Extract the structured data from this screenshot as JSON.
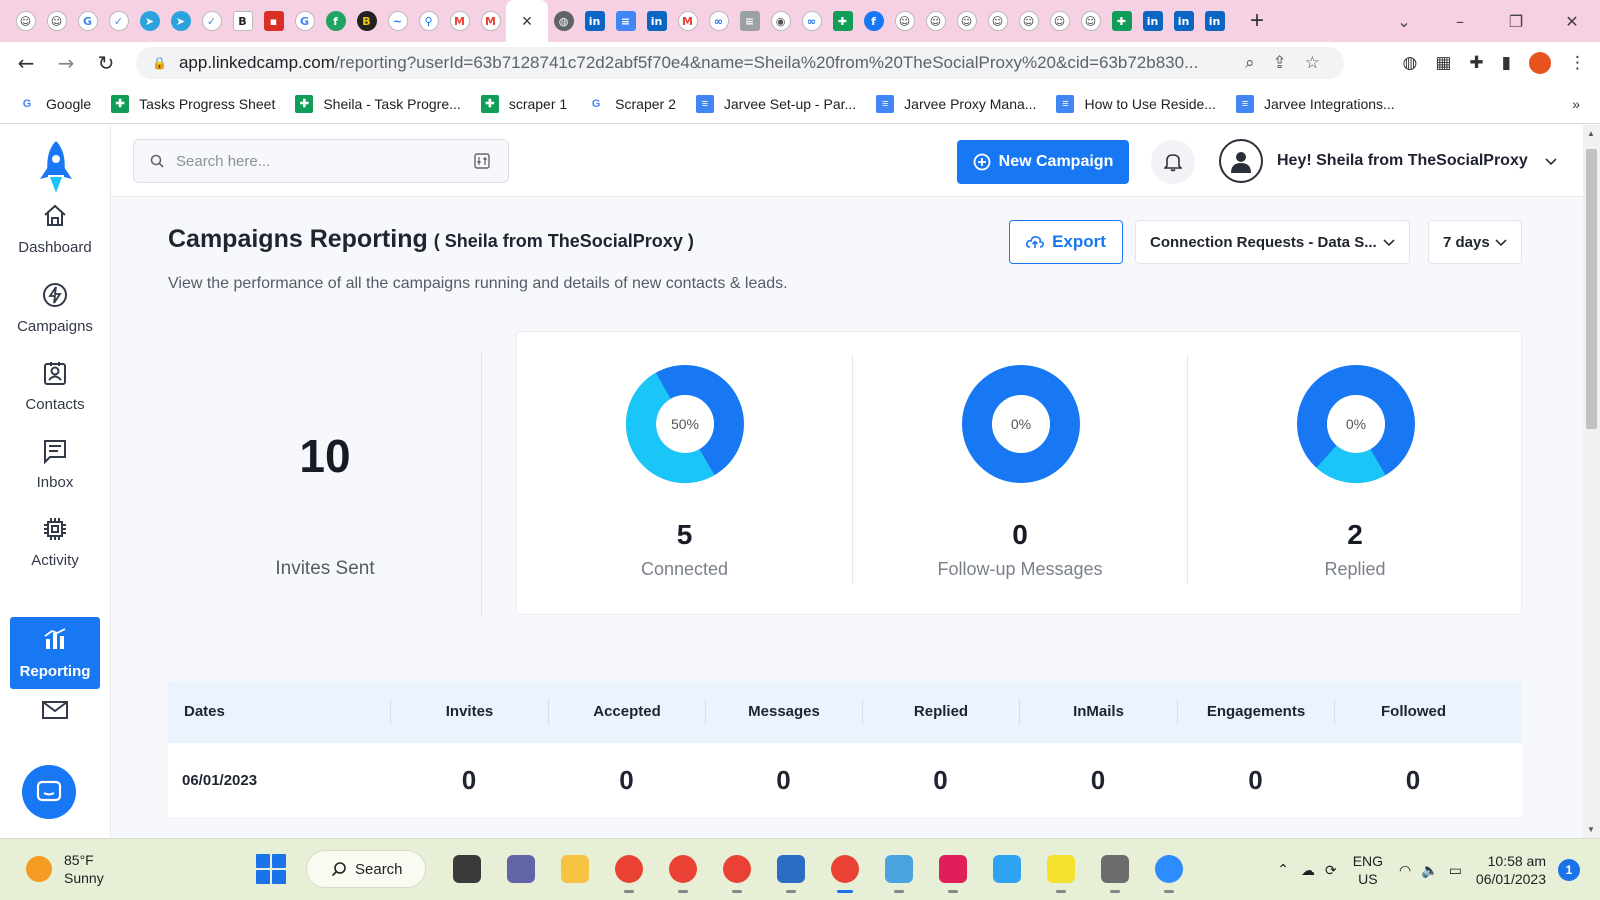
{
  "colors": {
    "accent": "#1877f2",
    "donut_primary": "#1877f2",
    "donut_secondary": "#19c6f7",
    "tab_strip": "#f6d1e4",
    "taskbar": "#e7f0d6"
  },
  "browser": {
    "tab_icons": [
      "chrome-dino-icon",
      "chrome-dino-icon",
      "google-icon",
      "double-check-icon",
      "telegram-icon",
      "telegram-icon",
      "double-check-icon",
      "bold-b-icon",
      "red-app-icon",
      "google-icon",
      "green-f-icon",
      "bh-icon",
      "blue-swirl-icon",
      "pin-icon",
      "gmail-icon",
      "gmail-icon"
    ],
    "active_tab_close": "×",
    "tab_icons_right": [
      "globe-icon",
      "linkedin-icon",
      "docs-icon",
      "linkedin-icon",
      "gmail-icon",
      "link-icon",
      "doc-icon",
      "chrome-icon",
      "link-icon",
      "sheets-icon",
      "facebook-icon",
      "chrome-dino-icon",
      "chrome-dino-icon",
      "chrome-dino-icon",
      "chrome-dino-icon",
      "chrome-dino-icon",
      "chrome-dino-icon",
      "chrome-dino-icon",
      "sheets-icon",
      "linkedin-icon",
      "linkedin-icon",
      "linkedin-icon"
    ],
    "url_host": "app.linkedcamp.com",
    "url_rest": "/reporting?userId=63b7128741c72d2abf5f70e4&name=Sheila%20from%20TheSocialProxy%20&cid=63b72b830...",
    "bookmarks": [
      {
        "label": "Google",
        "icon": "google-icon"
      },
      {
        "label": "Tasks Progress Sheet",
        "icon": "sheets-icon"
      },
      {
        "label": "Sheila - Task Progre...",
        "icon": "sheets-icon"
      },
      {
        "label": "scraper 1",
        "icon": "sheets-icon"
      },
      {
        "label": "Scraper 2",
        "icon": "google-icon"
      },
      {
        "label": "Jarvee Set-up - Par...",
        "icon": "docs-icon"
      },
      {
        "label": "Jarvee Proxy Mana...",
        "icon": "docs-icon"
      },
      {
        "label": "How to Use Reside...",
        "icon": "docs-icon"
      },
      {
        "label": "Jarvee Integrations...",
        "icon": "docs-icon"
      }
    ],
    "bookmarks_more": "»"
  },
  "sidebar": {
    "items": [
      {
        "label": "Dashboard",
        "icon": "home-icon"
      },
      {
        "label": "Campaigns",
        "icon": "lightning-icon"
      },
      {
        "label": "Contacts",
        "icon": "contact-card-icon"
      },
      {
        "label": "Inbox",
        "icon": "message-icon"
      },
      {
        "label": "Activity",
        "icon": "chip-icon"
      },
      {
        "label": "Reporting",
        "icon": "bar-chart-icon"
      }
    ]
  },
  "topbar": {
    "search_placeholder": "Search here...",
    "new_campaign": "New Campaign",
    "user_greeting": "Hey! Sheila from TheSocialProxy"
  },
  "page": {
    "title": "Campaigns Reporting",
    "title_sub": "( Sheila from TheSocialProxy )",
    "description": "View the performance of all the campaigns running and details of new contacts & leads.",
    "export": "Export",
    "campaign_select": "Connection Requests - Data S...",
    "period_select": "7 days"
  },
  "stats": {
    "invites_value": "10",
    "invites_label": "Invites Sent",
    "cards": [
      {
        "pct_label": "50%",
        "pct": 0.5,
        "value": "5",
        "label": "Connected"
      },
      {
        "pct_label": "0%",
        "pct": 0,
        "value": "0",
        "label": "Follow-up Messages"
      },
      {
        "pct_label": "0%",
        "pct": 0.2,
        "value": "2",
        "label": "Replied"
      }
    ]
  },
  "table": {
    "headers": [
      "Dates",
      "Invites",
      "Accepted",
      "Messages",
      "Replied",
      "InMails",
      "Engagements",
      "Followed"
    ],
    "rows": [
      [
        "06/01/2023",
        "0",
        "0",
        "0",
        "0",
        "0",
        "0",
        "0"
      ]
    ]
  },
  "taskbar": {
    "temp": "85°F",
    "condition": "Sunny",
    "search": "Search",
    "apps": [
      "task-view-icon",
      "teams-icon",
      "file-explorer-icon",
      "chrome-icon",
      "chrome-icon",
      "chrome-icon",
      "remote-desktop-icon",
      "chrome-icon",
      "notepad-icon",
      "slack-icon",
      "paint-icon",
      "todo-icon",
      "calculator-icon",
      "zoom-icon"
    ],
    "lang_top": "ENG",
    "lang_bottom": "US",
    "time": "10:58 am",
    "date": "06/01/2023",
    "notifications": "1"
  }
}
